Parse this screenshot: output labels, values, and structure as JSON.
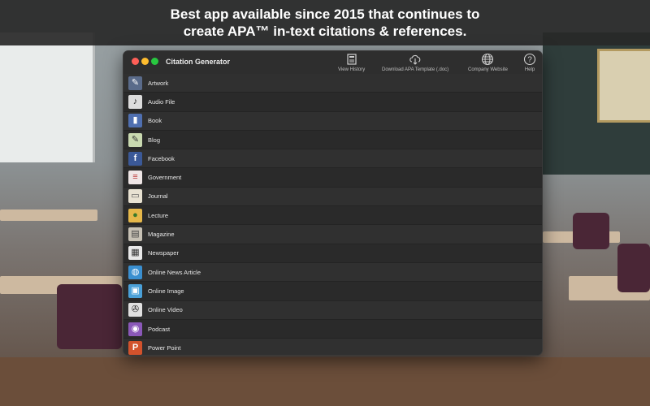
{
  "banner": {
    "line1": "Best app available since 2015 that continues to",
    "line2": "create APA™ in-text citations & references."
  },
  "window": {
    "title": "Citation Generator",
    "toolbar": [
      {
        "label": "View History",
        "icon": "history-icon"
      },
      {
        "label": "Download APA Template (.doc)",
        "icon": "cloud-download-icon"
      },
      {
        "label": "Company Website",
        "icon": "globe-icon"
      },
      {
        "label": "Help",
        "icon": "help-icon"
      }
    ]
  },
  "sources": [
    {
      "label": "Artwork",
      "icon": "artwork-icon",
      "color": "#5a6b8a",
      "glyph": "✎"
    },
    {
      "label": "Audio File",
      "icon": "audio-file-icon",
      "color": "#dcdcdc",
      "glyph": "♪"
    },
    {
      "label": "Book",
      "icon": "book-icon",
      "color": "#4f6fb0",
      "glyph": "📘"
    },
    {
      "label": "Blog",
      "icon": "blog-icon",
      "color": "#c9d9b0",
      "glyph": "✎"
    },
    {
      "label": "Facebook",
      "icon": "facebook-icon",
      "color": "#3b5998",
      "glyph": "f"
    },
    {
      "label": "Government",
      "icon": "government-icon",
      "color": "#efe6e6",
      "glyph": "≡"
    },
    {
      "label": "Journal",
      "icon": "journal-icon",
      "color": "#e8e2d2",
      "glyph": "▭"
    },
    {
      "label": "Lecture",
      "icon": "lecture-icon",
      "color": "#e6b84a",
      "glyph": "●"
    },
    {
      "label": "Magazine",
      "icon": "magazine-icon",
      "color": "#c7c1b5",
      "glyph": "▤"
    },
    {
      "label": "Newspaper",
      "icon": "newspaper-icon",
      "color": "#e8e8e8",
      "glyph": "▦"
    },
    {
      "label": "Online News Article",
      "icon": "online-news-icon",
      "color": "#3a8fd0",
      "glyph": "◍"
    },
    {
      "label": "Online Image",
      "icon": "online-image-icon",
      "color": "#4aa0d8",
      "glyph": "▣"
    },
    {
      "label": "Online Video",
      "icon": "online-video-icon",
      "color": "#e0e0e0",
      "glyph": "✇"
    },
    {
      "label": "Podcast",
      "icon": "podcast-icon",
      "color": "#8a58b8",
      "glyph": "◉"
    },
    {
      "label": "Power Point",
      "icon": "power-point-icon",
      "color": "#d2522c",
      "glyph": "P"
    }
  ]
}
